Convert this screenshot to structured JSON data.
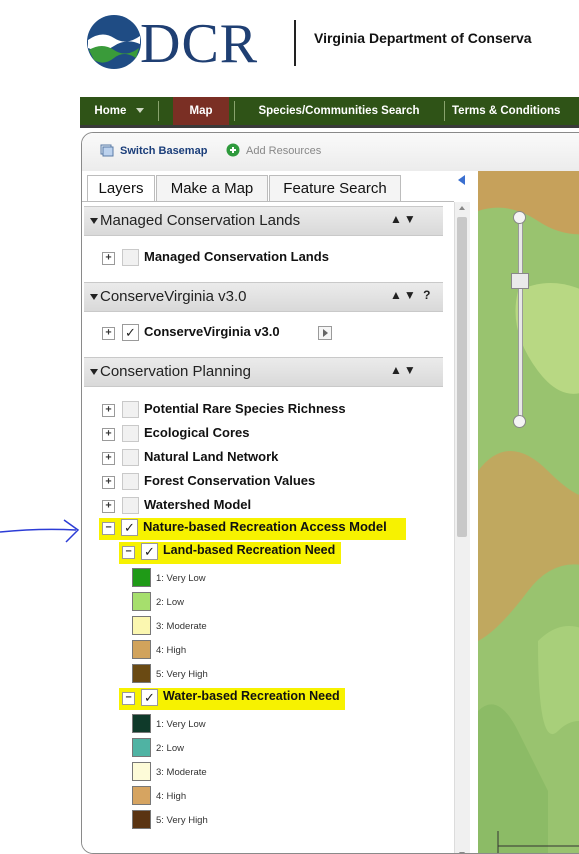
{
  "header": {
    "logo_text": "DCR",
    "agency_name": "Virginia Department of Conserva"
  },
  "nav": {
    "home": "Home",
    "map": "Map",
    "species": "Species/Communities Search",
    "terms": "Terms & Conditions"
  },
  "toolbar": {
    "switch_basemap": "Switch Basemap",
    "add_resources": "Add Resources"
  },
  "tabs": {
    "layers": "Layers",
    "make_map": "Make a Map",
    "feature_search": "Feature Search"
  },
  "sections": {
    "managed": {
      "title": "Managed Conservation Lands",
      "arrows": "▲▼",
      "item": "Managed Conservation Lands"
    },
    "conserve": {
      "title": "ConserveVirginia v3.0",
      "arrows": "▲▼ ?",
      "item": "ConserveVirginia v3.0"
    },
    "planning": {
      "title": "Conservation Planning",
      "arrows": "▲▼",
      "items": [
        "Potential Rare Species Richness",
        "Ecological Cores",
        "Natural Land Network",
        "Forest Conservation Values",
        "Watershed Model",
        "Nature-based Recreation Access Model"
      ],
      "land": {
        "title": "Land-based Recreation Need",
        "legend": [
          "1: Very Low",
          "2: Low",
          "3: Moderate",
          "4: High",
          "5: Very High"
        ],
        "colors": [
          "#1f9a17",
          "#a6df6d",
          "#fbf7b0",
          "#d1a35c",
          "#6a4a13"
        ]
      },
      "water": {
        "title": "Water-based Recreation Need",
        "legend": [
          "1: Very Low",
          "2: Low",
          "3: Moderate",
          "4: High",
          "5: Very High"
        ],
        "colors": [
          "#0f3a2a",
          "#4fb3a3",
          "#fdfbd8",
          "#d6a461",
          "#5a3412"
        ]
      }
    }
  },
  "checkmark": "✓",
  "collapse": "−",
  "expand": "+"
}
